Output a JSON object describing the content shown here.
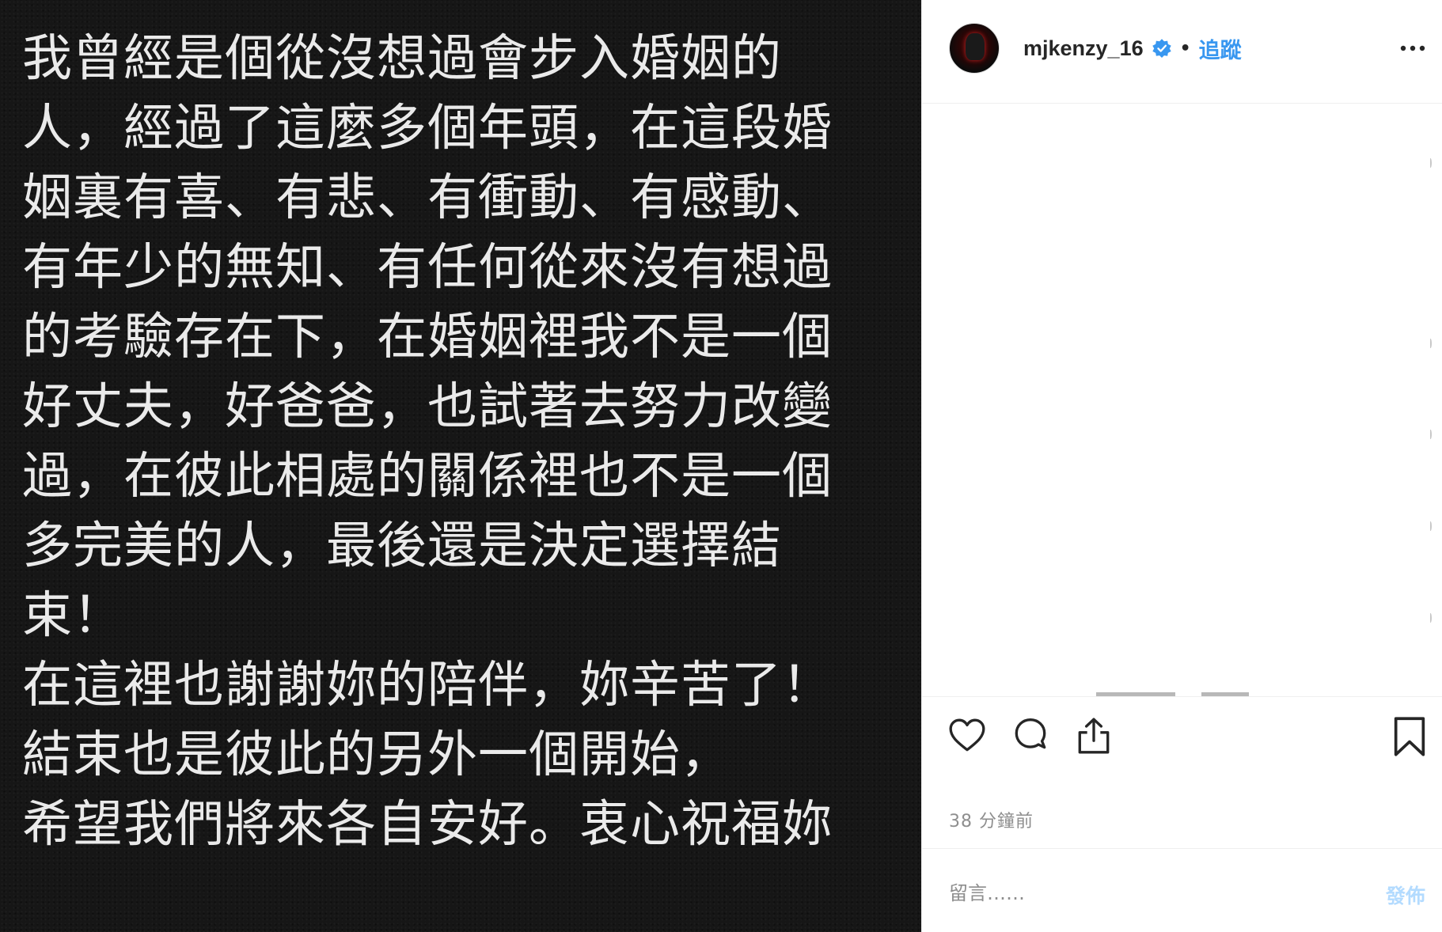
{
  "post_image": {
    "text_lines": [
      "我曾經是個從沒想過會步入婚姻的",
      "人，經過了這麼多個年頭，在這段婚",
      "姻裏有喜、有悲、有衝動、有感動、",
      "有年少的無知、有任何從來沒有想過",
      "的考驗存在下，在婚姻裡我不是一個",
      "好丈夫，好爸爸，也試著去努力改變",
      "過，在彼此相處的關係裡也不是一個",
      "多完美的人，最後還是決定選擇結",
      "束！",
      "在這裡也謝謝妳的陪伴，妳辛苦了！",
      "結束也是彼此的另外一個開始，",
      "希望我們將來各自安好。衷心祝福妳"
    ]
  },
  "header": {
    "username": "mjkenzy_16",
    "separator": "•",
    "follow_label": "追蹤"
  },
  "footer": {
    "timestamp": "38 分鐘前",
    "comment_placeholder": "留言……",
    "post_label": "發佈"
  },
  "colors": {
    "accent": "#3897f0",
    "post_disabled": "#b3dbff",
    "muted": "#8e8e8e",
    "image_background": "#161616"
  },
  "icons": [
    "verified-badge-icon",
    "more-options-icon",
    "heart-icon",
    "comment-icon",
    "share-icon",
    "bookmark-icon"
  ]
}
